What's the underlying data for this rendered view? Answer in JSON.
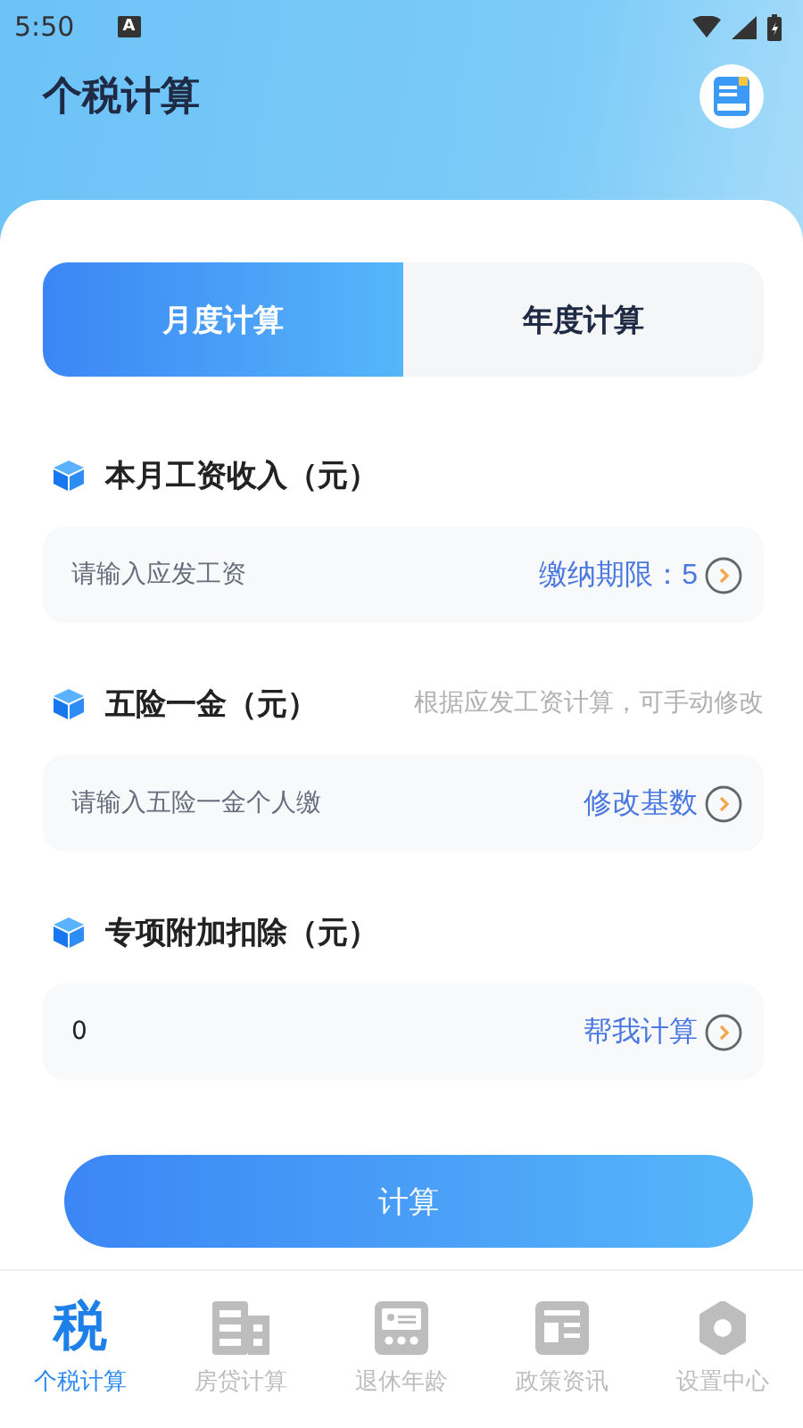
{
  "status_bar": {
    "time": "5:50",
    "badge": "A"
  },
  "header": {
    "title": "个税计算"
  },
  "tabs": [
    {
      "label": "月度计算",
      "selected": true
    },
    {
      "label": "年度计算",
      "selected": false
    }
  ],
  "sections": [
    {
      "title": "本月工资收入（元）",
      "field": {
        "placeholder": "请输入应发工资"
      },
      "action": "缴纳期限：5"
    },
    {
      "title": "五险一金（元）",
      "hint": "根据应发工资计算，可手动修改",
      "field": {
        "placeholder": "请输入五险一金个人缴"
      },
      "action": "修改基数"
    },
    {
      "title": "专项附加扣除（元）",
      "field": {
        "value": "0"
      },
      "action": "帮我计算"
    }
  ],
  "submit": "计算",
  "nav": [
    {
      "kind": "tax",
      "glyph": "税",
      "label": "个税计算",
      "selected": true
    },
    {
      "kind": "building",
      "label": "房贷计算",
      "selected": false
    },
    {
      "kind": "card",
      "label": "退休年龄",
      "selected": false
    },
    {
      "kind": "news",
      "label": "政策资讯",
      "selected": false
    },
    {
      "kind": "gear",
      "label": "设置中心",
      "selected": false
    }
  ]
}
